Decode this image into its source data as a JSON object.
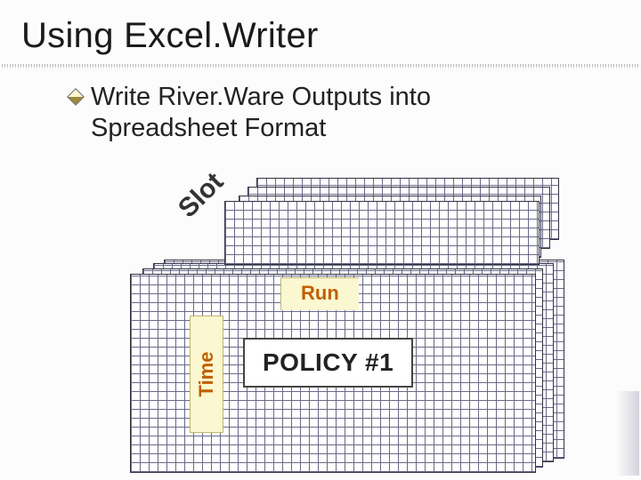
{
  "title": "Using Excel.Writer",
  "bullet": "Write River.Ware Outputs into Spreadsheet Format",
  "labels": {
    "slot": "Slot",
    "run": "Run",
    "time": "Time",
    "policy": "POLICY #1"
  }
}
